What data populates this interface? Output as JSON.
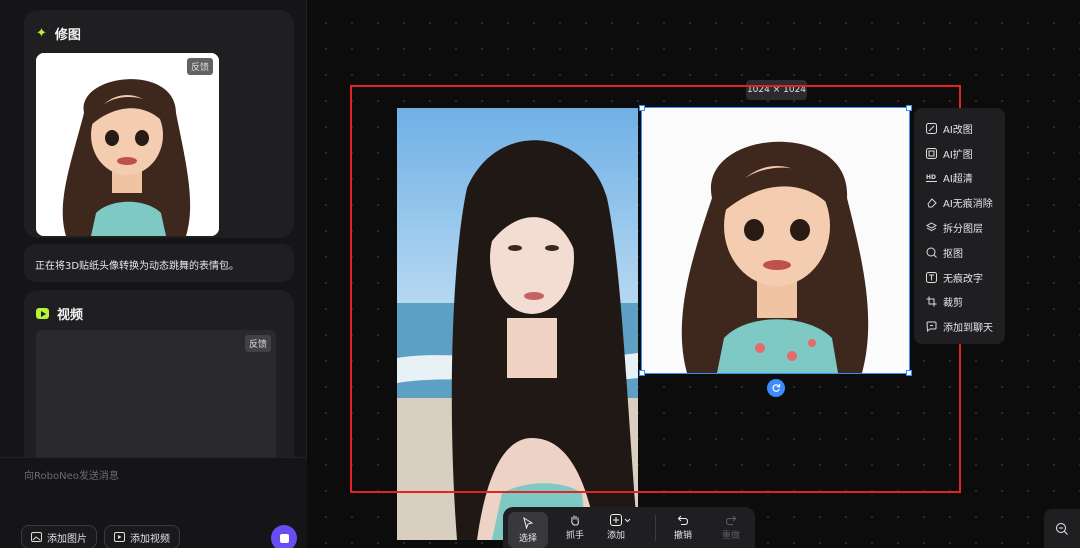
{
  "chat": {
    "retouch_card": {
      "title": "修图",
      "feedback": "反馈"
    },
    "status_message": "正在将3D贴纸头像转换为动态跳舞的表情包。",
    "video_card": {
      "title": "视频",
      "feedback": "反馈"
    },
    "composer": {
      "placeholder": "向RoboNeo发送消息",
      "add_image": "添加图片",
      "add_video": "添加视频"
    }
  },
  "canvas": {
    "selection_size": "1024 × 1024",
    "context_menu": [
      {
        "label": "AI改图",
        "icon": "ai-edit-icon"
      },
      {
        "label": "AI扩图",
        "icon": "ai-expand-icon"
      },
      {
        "label": "AI超清",
        "icon": "hd-icon"
      },
      {
        "label": "AI无痕消除",
        "icon": "eraser-icon"
      },
      {
        "label": "拆分图层",
        "icon": "layers-icon"
      },
      {
        "label": "抠图",
        "icon": "cutout-icon"
      },
      {
        "label": "无痕改字",
        "icon": "text-edit-icon"
      },
      {
        "label": "裁剪",
        "icon": "crop-icon"
      },
      {
        "label": "添加到聊天",
        "icon": "chat-add-icon"
      }
    ]
  },
  "toolbar": {
    "select": "选择",
    "hand": "抓手",
    "add": "添加",
    "undo": "撤销",
    "redo": "重做"
  },
  "colors": {
    "accent_green": "#b5f23d",
    "selection_blue": "#3d8bff",
    "send_purple": "#6a4cf5",
    "highlight_red": "#e12323"
  }
}
